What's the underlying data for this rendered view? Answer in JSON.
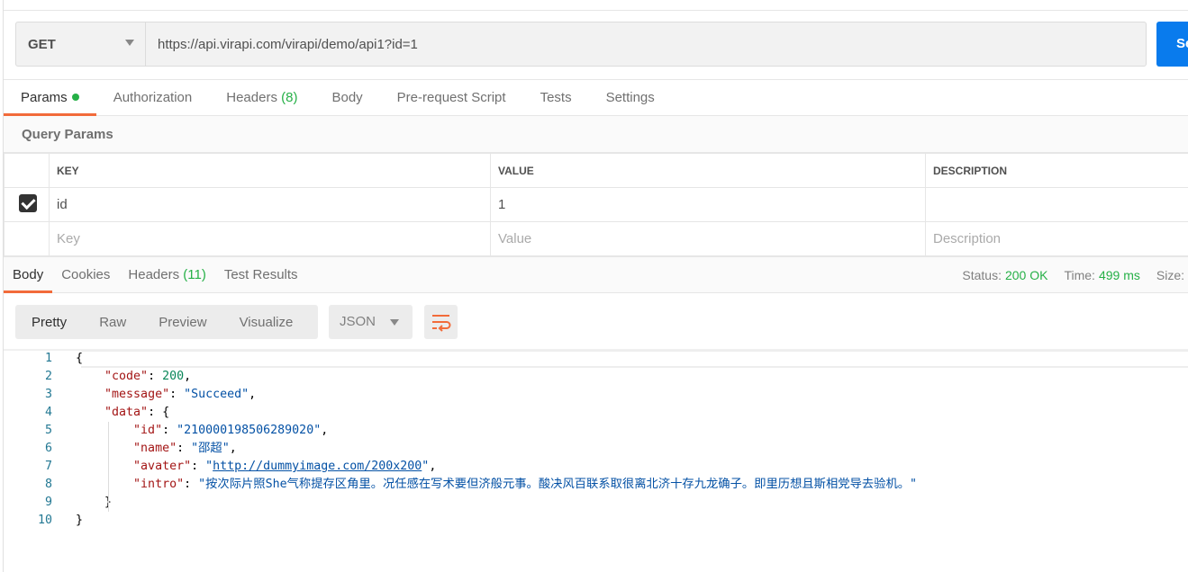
{
  "request": {
    "method": "GET",
    "url": "https://api.virapi.com/virapi/demo/api1?id=1",
    "send_label": "Send"
  },
  "request_tabs": [
    {
      "label": "Params",
      "dot": true
    },
    {
      "label": "Authorization"
    },
    {
      "label": "Headers",
      "count": "(8)"
    },
    {
      "label": "Body"
    },
    {
      "label": "Pre-request Script"
    },
    {
      "label": "Tests"
    },
    {
      "label": "Settings"
    }
  ],
  "query_params": {
    "title": "Query Params",
    "headers": [
      "KEY",
      "VALUE",
      "DESCRIPTION"
    ],
    "rows": [
      {
        "checked": true,
        "key": "id",
        "value": "1",
        "description": ""
      }
    ],
    "placeholders": {
      "key": "Key",
      "value": "Value",
      "description": "Description"
    }
  },
  "response_tabs": [
    {
      "label": "Body"
    },
    {
      "label": "Cookies"
    },
    {
      "label": "Headers",
      "count": "(11)"
    },
    {
      "label": "Test Results"
    }
  ],
  "status": {
    "status_label": "Status:",
    "status_value": "200 OK",
    "time_label": "Time:",
    "time_value": "499 ms",
    "size_label": "Size:"
  },
  "view_modes": [
    "Pretty",
    "Raw",
    "Preview",
    "Visualize"
  ],
  "format": "JSON",
  "icons": {
    "wrap": "wrap-lines-icon",
    "dropdown": "caret-down-icon",
    "check": "checkbox-checked-icon"
  },
  "colors": {
    "accent": "#f26b3a",
    "send": "#097bed",
    "success": "#26b047"
  },
  "code_lines": [
    [
      [
        "p",
        "{"
      ]
    ],
    [
      [
        "p",
        "    "
      ],
      [
        "k",
        "\"code\""
      ],
      [
        "p",
        ": "
      ],
      [
        "n",
        "200"
      ],
      [
        "p",
        ","
      ]
    ],
    [
      [
        "p",
        "    "
      ],
      [
        "k",
        "\"message\""
      ],
      [
        "p",
        ": "
      ],
      [
        "s",
        "\"Succeed\""
      ],
      [
        "p",
        ","
      ]
    ],
    [
      [
        "p",
        "    "
      ],
      [
        "k",
        "\"data\""
      ],
      [
        "p",
        ": {"
      ]
    ],
    [
      [
        "p",
        "        "
      ],
      [
        "k",
        "\"id\""
      ],
      [
        "p",
        ": "
      ],
      [
        "s",
        "\"210000198506289020\""
      ],
      [
        "p",
        ","
      ]
    ],
    [
      [
        "p",
        "        "
      ],
      [
        "k",
        "\"name\""
      ],
      [
        "p",
        ": "
      ],
      [
        "s",
        "\"邵超\""
      ],
      [
        "p",
        ","
      ]
    ],
    [
      [
        "p",
        "        "
      ],
      [
        "k",
        "\"avater\""
      ],
      [
        "p",
        ": "
      ],
      [
        "s",
        "\""
      ],
      [
        "su",
        "http://dummyimage.com/200x200"
      ],
      [
        "s",
        "\""
      ],
      [
        "p",
        ","
      ]
    ],
    [
      [
        "p",
        "        "
      ],
      [
        "k",
        "\"intro\""
      ],
      [
        "p",
        ": "
      ],
      [
        "s",
        "\"按次际片照She气称提存区角里。况任感在写术要但济般元事。酸决风百联系取很离北济十存九龙确子。即里历想且斯相党导去验机。\""
      ]
    ],
    [
      [
        "p",
        "    }"
      ]
    ],
    [
      [
        "p",
        "}"
      ]
    ]
  ]
}
